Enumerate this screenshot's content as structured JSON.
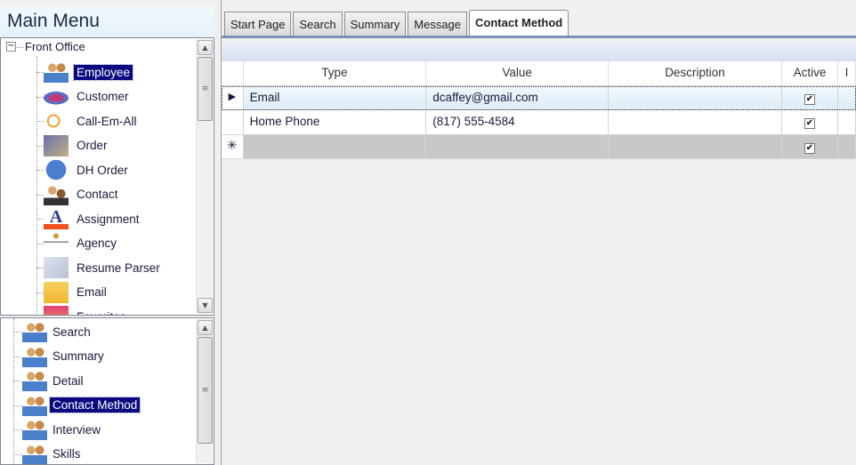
{
  "left_panel": {
    "title": "Main Menu",
    "tree_root": "Front Office",
    "front_office_items": [
      {
        "label": "Employee",
        "icon": "employee-people-icon",
        "selected": true
      },
      {
        "label": "Customer",
        "icon": "customer-pie-icon"
      },
      {
        "label": "Call-Em-All",
        "icon": "call-broadcast-icon"
      },
      {
        "label": "Order",
        "icon": "order-search-icon"
      },
      {
        "label": "DH Order",
        "icon": "dh-order-dice-icon"
      },
      {
        "label": "Contact",
        "icon": "contact-people-icon"
      },
      {
        "label": "Assignment",
        "icon": "assignment-letter-icon"
      },
      {
        "label": "Agency",
        "icon": "agency-org-chart-icon"
      },
      {
        "label": "Resume Parser",
        "icon": "resume-upload-icon"
      },
      {
        "label": "Email",
        "icon": "email-envelope-icon"
      },
      {
        "label": "Favorites",
        "icon": "favorites-icon"
      }
    ],
    "employee_items": [
      {
        "label": "Search"
      },
      {
        "label": "Summary"
      },
      {
        "label": "Detail"
      },
      {
        "label": "Contact Method",
        "selected": true
      },
      {
        "label": "Interview"
      },
      {
        "label": "Skills"
      }
    ]
  },
  "tabs": [
    {
      "label": "Start Page"
    },
    {
      "label": "Search"
    },
    {
      "label": "Summary"
    },
    {
      "label": "Message"
    },
    {
      "label": "Contact Method",
      "active": true
    }
  ],
  "grid": {
    "columns": [
      "Type",
      "Value",
      "Description",
      "Active",
      "I"
    ],
    "rows": [
      {
        "type": "Email",
        "value": "dcaffey@gmail.com",
        "description": "",
        "active": true,
        "current": true
      },
      {
        "type": "Home Phone",
        "value": "(817) 555-4584",
        "description": "",
        "active": true
      },
      {
        "type": "",
        "value": "",
        "description": "",
        "active": true,
        "new_row": true
      }
    ]
  },
  "colors": {
    "selection": "#0a0a80",
    "tab_line": "#7d92b6"
  }
}
